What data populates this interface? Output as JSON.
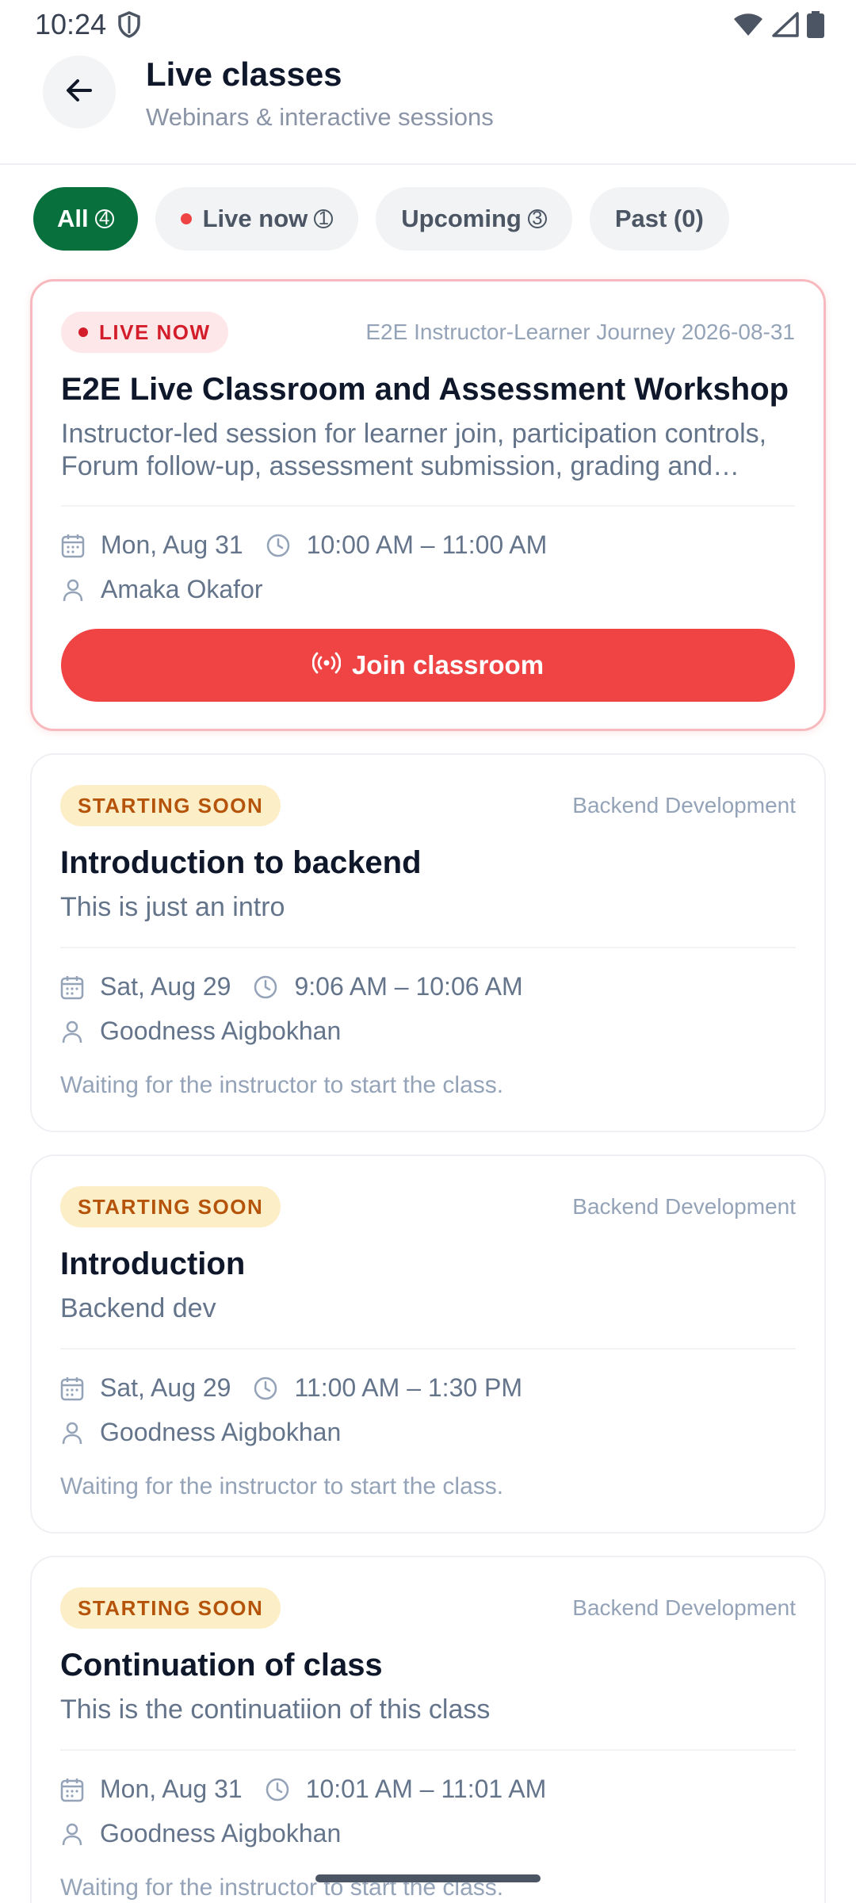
{
  "status_bar": {
    "time": "10:24"
  },
  "header": {
    "title": "Live classes",
    "subtitle": "Webinars & interactive sessions"
  },
  "tabs": [
    {
      "label": "All",
      "count": "4"
    },
    {
      "label": "Live now",
      "count": "1"
    },
    {
      "label": "Upcoming",
      "count": "3"
    },
    {
      "label": "Past (0)"
    }
  ],
  "cards": [
    {
      "badge": "LIVE NOW",
      "course": "E2E Instructor-Learner Journey 2026-08-31",
      "title": "E2E Live Classroom and Assessment Workshop",
      "description": "Instructor-led session for learner join, participation controls, Forum follow-up, assessment submission, grading and results.",
      "date": "Mon, Aug 31",
      "time": "10:00 AM – 11:00 AM",
      "instructor": "Amaka Okafor",
      "action_label": "Join classroom"
    },
    {
      "badge": "STARTING SOON",
      "course": "Backend Development",
      "title": "Introduction to backend",
      "description": "This is just an intro",
      "date": "Sat, Aug 29",
      "time": "9:06 AM – 10:06 AM",
      "instructor": "Goodness Aigbokhan",
      "status_note": "Waiting for the instructor to start the class."
    },
    {
      "badge": "STARTING SOON",
      "course": "Backend Development",
      "title": "Introduction",
      "description": "Backend dev",
      "date": "Sat, Aug 29",
      "time": "11:00 AM – 1:30 PM",
      "instructor": "Goodness Aigbokhan",
      "status_note": "Waiting for the instructor to start the class."
    },
    {
      "badge": "STARTING SOON",
      "course": "Backend Development",
      "title": "Continuation of class",
      "description": "This is the continuatiion of this class",
      "date": "Mon, Aug 31",
      "time": "10:01 AM – 11:01 AM",
      "instructor": "Goodness Aigbokhan",
      "status_note": "Waiting for the instructor to start the class."
    }
  ],
  "icons": {
    "back": "arrow-left-icon",
    "calendar": "calendar-icon",
    "clock": "clock-icon",
    "person": "person-icon",
    "broadcast": "broadcast-icon"
  },
  "colors": {
    "primary_green": "#07703c",
    "live_red": "#ef4344",
    "soon_amber": "#b45309",
    "soon_bg": "#fcefc7",
    "live_badge_bg": "#fde7e9"
  }
}
